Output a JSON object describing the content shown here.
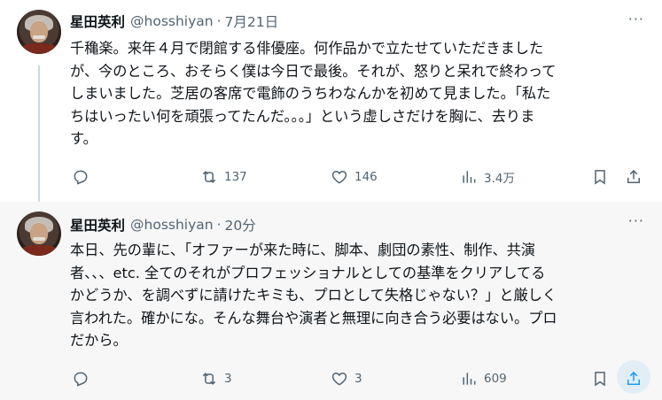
{
  "tweets": [
    {
      "name": "星田英利",
      "handle": "@hosshiyan",
      "separator": "·",
      "time": "7月21日",
      "more": "···",
      "text": "千穐楽。来年４月で閉館する俳優座。何作品かで立たせていただきましたが、今のところ、おそらく僕は今日で最後。それが、怒りと呆れで終わってしまいました。芝居の客席で電飾のうちわなんかを初めて見ました。「私たちはいったい何を頑張ってたんだ。。。」という虚しさだけを胸に、去ります。",
      "lines": [
        "千穐楽。来年４月で閉館する俳優座。何作品かで立たせていただきまし",
        "た",
        "が、今のところ、おそらく僕は今日で最後。それが、怒りと呆れで終わって",
        "しまいました。芝居の客席で電飾のうちわなんかを初めて見ました。「私た",
        "ちはいったい何を頑張ってたんだ。。。」という虚しさだけを胸に、去りま",
        "す。"
      ],
      "replies": "",
      "retweets": "137",
      "likes": "146",
      "views": "3.4万"
    },
    {
      "name": "星田英利",
      "handle": "@hosshiyan",
      "separator": "·",
      "time": "20分",
      "more": "···",
      "lines": [
        "本日、先の輩に、「オファーが来た時に、脚本、劇団の素性、制作、共演",
        "者、、、etc. 全てのそれがプロフェッショナルとしての基準をクリアしてる",
        "かどうか、を調べずに請けたキミも、プロとして失格じゃない？」と厳しく",
        "言われた。確かにな。そんな舞台や演者と無理に向き合う必要はない。プロ",
        "だから。"
      ],
      "replies": "",
      "retweets": "3",
      "likes": "3",
      "views": "609"
    }
  ],
  "icons": {
    "reply": "reply-icon",
    "retweet": "retweet-icon",
    "like": "heart-icon",
    "views": "views-icon",
    "bookmark": "bookmark-icon",
    "share": "share-icon"
  },
  "colors": {
    "text": "#0f1419",
    "secondary": "#536471",
    "accent": "#1d9bf0",
    "thread_line": "#cfd9de"
  }
}
